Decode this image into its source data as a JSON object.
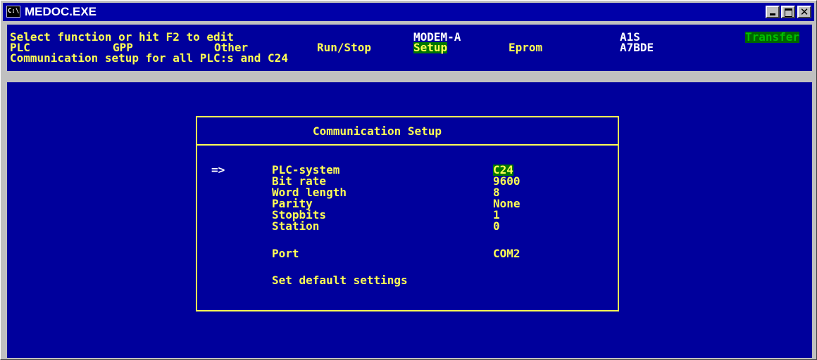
{
  "window": {
    "title": "MEDOC.EXE",
    "icon": "C:\\"
  },
  "controls": {
    "minimize": "minimize-icon",
    "maximize": "maximize-icon",
    "close": "close-icon",
    "close_glyph": "✕"
  },
  "header": {
    "prompt": "Select function or hit F2 to edit",
    "connection": "MODEM-A",
    "cpu": "A1S",
    "mode": "Transfer",
    "cpu_model": "A7BDE",
    "description": "Communication setup for all PLC:s and C24"
  },
  "menu": {
    "items": [
      "PLC",
      "GPP",
      "Other",
      "Run/Stop",
      "Setup",
      "Eprom"
    ],
    "selected": "Setup"
  },
  "dialog": {
    "title": "Communication Setup",
    "cursor": "=>",
    "fields": [
      {
        "label": "PLC-system",
        "value": "C24"
      },
      {
        "label": "Bit rate",
        "value": "9600"
      },
      {
        "label": "Word length",
        "value": "8"
      },
      {
        "label": "Parity",
        "value": "None"
      },
      {
        "label": "Stopbits",
        "value": "1"
      },
      {
        "label": "Station",
        "value": "0"
      }
    ],
    "port": {
      "label": "Port",
      "value": "COM2"
    },
    "default_action": "Set default settings"
  },
  "colors": {
    "background": "#00009c",
    "text": "#ffff54",
    "highlight": "#007800",
    "titlebar": "#0000a8"
  }
}
